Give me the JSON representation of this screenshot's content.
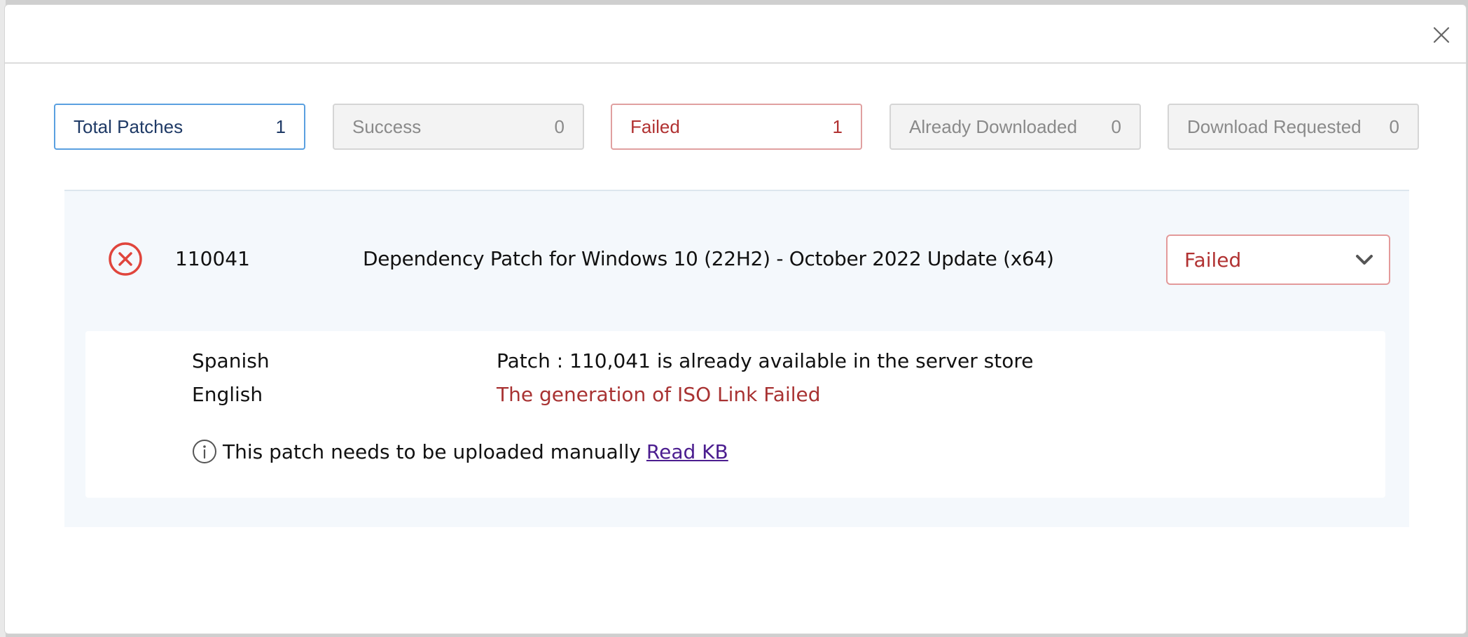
{
  "stats": [
    {
      "label": "Total Patches",
      "count": "1"
    },
    {
      "label": "Success",
      "count": "0"
    },
    {
      "label": "Failed",
      "count": "1"
    },
    {
      "label": "Already Downloaded",
      "count": "0"
    },
    {
      "label": "Download Requested",
      "count": "0"
    }
  ],
  "patch": {
    "id": "110041",
    "title": "Dependency Patch for Windows 10 (22H2) - October 2022 Update (x64)",
    "status": "Failed",
    "status_icon": "error-circle-icon"
  },
  "details": [
    {
      "language": "Spanish",
      "message": "Patch : 110,041 is already available in the server store"
    },
    {
      "language": "English",
      "message": "The generation of ISO Link Failed"
    }
  ],
  "note": {
    "text": "This patch needs to be uploaded manually",
    "link_label": "Read KB"
  },
  "colors": {
    "failed": "#b13232",
    "total_border": "#5aa0e0",
    "link": "#4b1d8f"
  }
}
